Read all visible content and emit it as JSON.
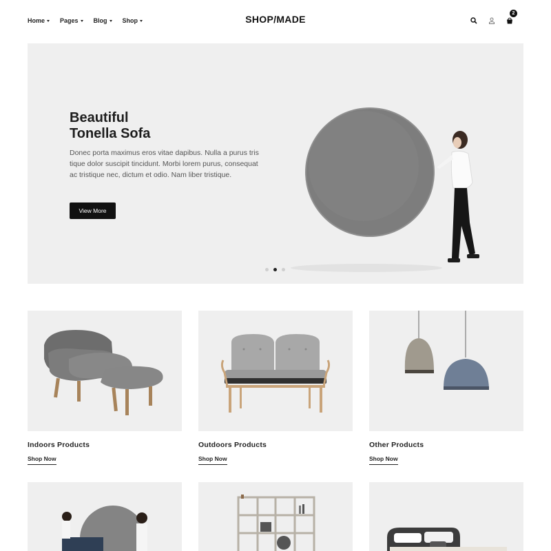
{
  "header": {
    "logo": "SHOP/MADE",
    "nav": [
      {
        "label": "Home"
      },
      {
        "label": "Pages"
      },
      {
        "label": "Blog"
      },
      {
        "label": "Shop"
      }
    ],
    "cart_count": "2",
    "icons": [
      "search-icon",
      "user-icon",
      "cart-icon"
    ]
  },
  "hero": {
    "title": "Beautiful\nTonella Sofa",
    "text": "Donec porta maximus eros vitae dapibus. Nulla a purus tris tique dolor suscipit tincidunt. Morbi lorem purus, consequat ac tristique nec, dictum et odio. Nam liber tristique.",
    "button": "View More",
    "active_slide": 2,
    "slide_count": 3
  },
  "products": [
    {
      "title": "Indoors Products",
      "link": "Shop Now"
    },
    {
      "title": "Outdoors Products",
      "link": "Shop Now"
    },
    {
      "title": "Other Products",
      "link": "Shop Now"
    }
  ],
  "colors": {
    "accent": "#111111",
    "panel_bg": "#efefef",
    "text": "#222222"
  }
}
